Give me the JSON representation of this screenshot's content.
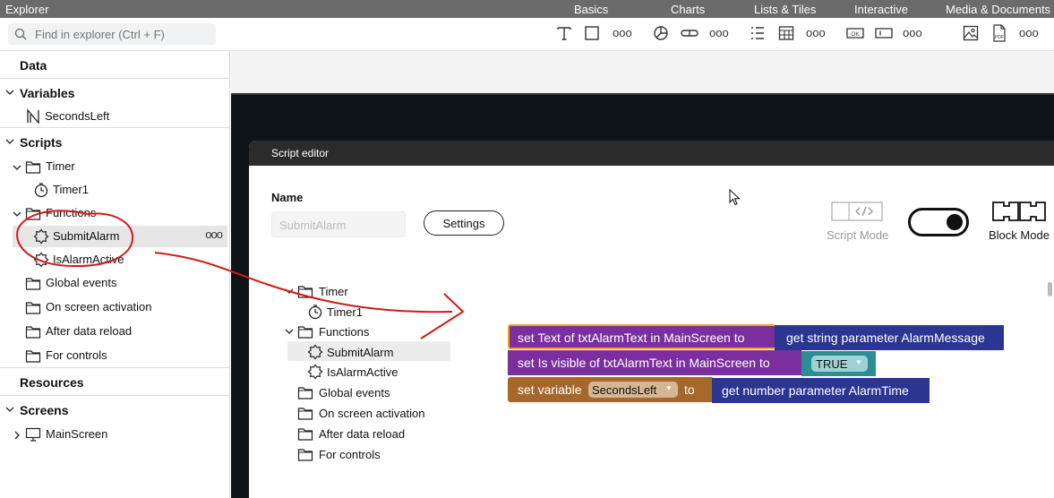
{
  "topbar": {
    "title": "Explorer",
    "tabs": [
      "Basics",
      "Charts",
      "Lists & Tiles",
      "Interactive",
      "Media & Documents"
    ]
  },
  "search": {
    "placeholder": "Find in explorer (Ctrl + F)"
  },
  "sidebar": {
    "data_title": "Data",
    "variables_title": "Variables",
    "variables": [
      "SecondsLeft"
    ],
    "scripts_title": "Scripts",
    "scripts": {
      "timer_folder": "Timer",
      "timer_item": "Timer1",
      "functions_folder": "Functions",
      "functions": [
        "SubmitAlarm",
        "IsAlarmActive"
      ],
      "folders": [
        "Global events",
        "On screen activation",
        "After data reload",
        "For controls"
      ]
    },
    "resources_title": "Resources",
    "screens_title": "Screens",
    "screens": [
      "MainScreen"
    ],
    "more_label": "ooo"
  },
  "editor": {
    "title": "Script editor",
    "name_label": "Name",
    "name_value": "SubmitAlarm",
    "settings_label": "Settings",
    "script_mode_label": "Script Mode",
    "block_mode_label": "Block Mode",
    "tree": {
      "timer_folder": "Timer",
      "timer_item": "Timer1",
      "functions_folder": "Functions",
      "functions": [
        "SubmitAlarm",
        "IsAlarmActive"
      ],
      "folders": [
        "Global events",
        "On screen activation",
        "After data reload",
        "For controls"
      ]
    },
    "blocks": {
      "b1_left": "set Text of txtAlarmText in MainScreen to",
      "b1_right": "get string parameter AlarmMessage",
      "b2_left": "set Is visible of txtAlarmText in MainScreen to",
      "b2_value": "TRUE",
      "b3_left": "set variable",
      "b3_var": "SecondsLeft",
      "b3_to": "to",
      "b3_right": "get number parameter AlarmTime"
    },
    "colors": {
      "purple": "#7b2f9e",
      "navy": "#2b3592",
      "teal": "#2b8e95",
      "brown": "#a5682a",
      "highlight": "#f7a21b"
    }
  },
  "annotation_color": "#d11a1a"
}
